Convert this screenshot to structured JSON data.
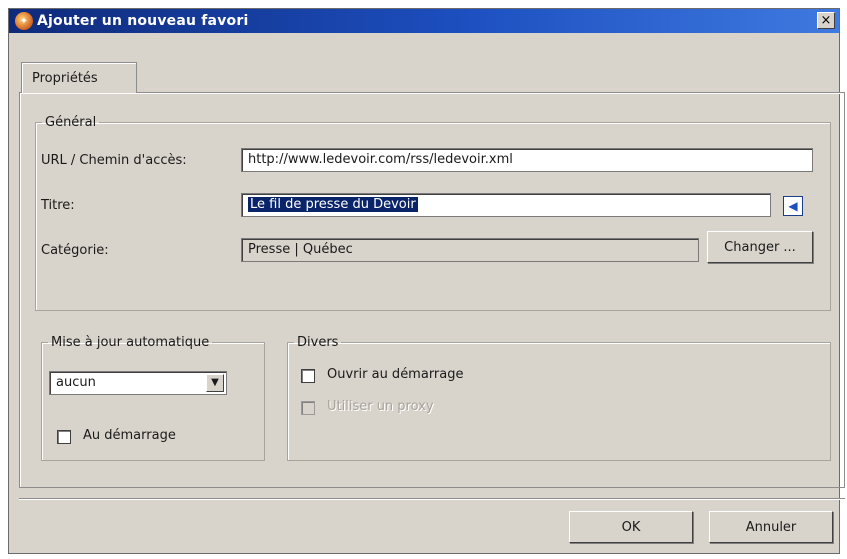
{
  "window": {
    "title": "Ajouter un nouveau favori",
    "close_glyph": "×"
  },
  "tabs": [
    {
      "label": "Propriétés"
    }
  ],
  "general": {
    "legend": "Général",
    "url_label": "URL / Chemin d'accès:",
    "url_value": "http://www.ledevoir.com/rss/ledevoir.xml",
    "title_label": "Titre:",
    "title_value": "Le fil de presse du Devoir",
    "feed_icon": "rss-feed-icon",
    "category_label": "Catégorie:",
    "category_value": "Presse | Québec",
    "change_button": "Changer ..."
  },
  "auto_update": {
    "legend": "Mise à jour automatique",
    "select_value": "aucun",
    "startup_label": "Au démarrage",
    "startup_checked": false
  },
  "misc": {
    "legend": "Divers",
    "open_on_startup_label": "Ouvrir au démarrage",
    "open_on_startup_checked": false,
    "use_proxy_label": "Utiliser un proxy",
    "use_proxy_checked": false,
    "use_proxy_disabled": true
  },
  "buttons": {
    "ok": "OK",
    "cancel": "Annuler"
  },
  "colors": {
    "title_bar": "#1d4fc0",
    "dialog_bg": "#d8d4cc",
    "selection": "#0a246a"
  }
}
